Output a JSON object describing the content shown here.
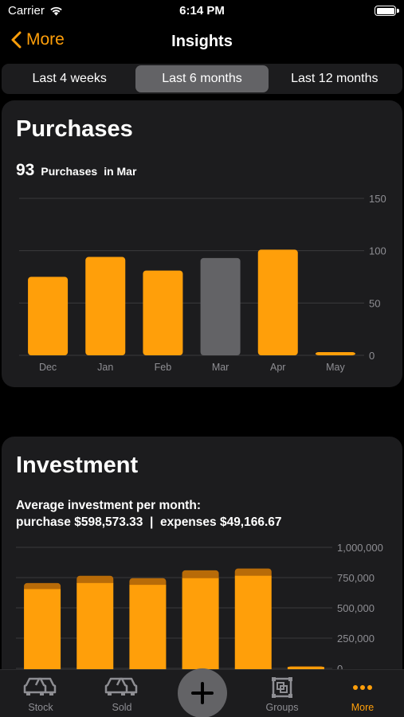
{
  "status": {
    "carrier": "Carrier",
    "time": "6:14 PM"
  },
  "nav": {
    "back_label": "More",
    "title": "Insights"
  },
  "segments": [
    {
      "label": "Last 4 weeks",
      "selected": false
    },
    {
      "label": "Last 6 months",
      "selected": true
    },
    {
      "label": "Last 12 months",
      "selected": false
    }
  ],
  "purchases": {
    "title": "Purchases",
    "count": "93",
    "count_label": "Purchases",
    "period_label": "in Mar"
  },
  "investment": {
    "title": "Investment",
    "line1": "Average investment per month:",
    "line2": "purchase $598,573.33  |  expenses $49,166.67"
  },
  "tabs": {
    "stock": "Stock",
    "sold": "Sold",
    "groups": "Groups",
    "more": "More"
  },
  "colors": {
    "accent": "#ff9f0a",
    "dark_accent": "#b86b08",
    "selected_bar": "#636366",
    "card": "#1c1c1e"
  },
  "chart_data": [
    {
      "type": "bar",
      "categories": [
        "Dec",
        "Jan",
        "Feb",
        "Mar",
        "Apr",
        "May"
      ],
      "values": [
        75,
        94,
        81,
        93,
        101,
        3
      ],
      "highlight": "Mar",
      "yticks": [
        "0",
        "50",
        "100",
        "150"
      ],
      "ylim": [
        0,
        150
      ],
      "grid": true
    },
    {
      "type": "bar",
      "stacked": true,
      "series": [
        {
          "values": [
            655000,
            705000,
            690000,
            745000,
            765000,
            12000
          ]
        },
        {
          "values": [
            50000,
            60000,
            55000,
            65000,
            60000,
            5000
          ]
        }
      ],
      "yticks": [
        "0",
        "250,000",
        "500,000",
        "750,000",
        "1,000,000"
      ],
      "ylim": [
        0,
        1000000
      ],
      "grid": true
    }
  ]
}
